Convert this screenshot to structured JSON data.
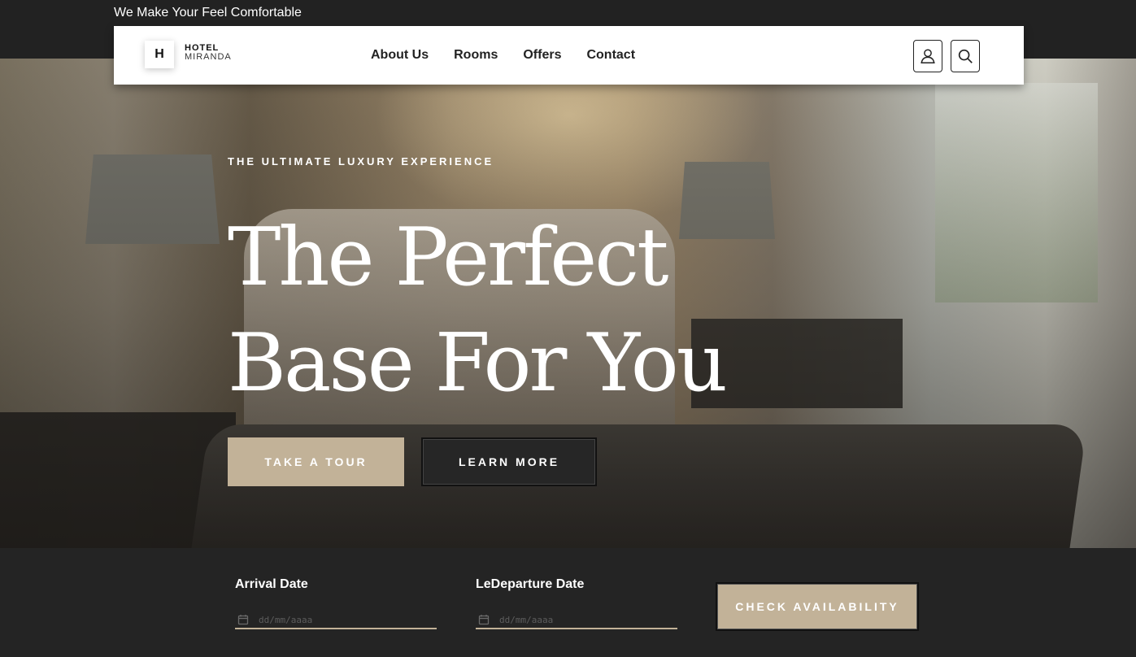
{
  "topbar": {
    "tagline": "We Make Your Feel Comfortable"
  },
  "brand": {
    "mark": "H",
    "line1": "HOTEL",
    "line2": "MIRANDA"
  },
  "nav": {
    "items": [
      {
        "label": "About Us"
      },
      {
        "label": "Rooms"
      },
      {
        "label": "Offers"
      },
      {
        "label": "Contact"
      }
    ],
    "icons": [
      "user-icon",
      "search-icon"
    ]
  },
  "hero": {
    "eyebrow": "THE ULTIMATE LUXURY EXPERIENCE",
    "headline_line1": "The Perfect",
    "headline_line2": "Base For You",
    "primary_button": "TAKE A TOUR",
    "secondary_button": "LEARN MORE"
  },
  "booking": {
    "arrival_label": "Arrival Date",
    "arrival_placeholder": "dd/mm/aaaa",
    "departure_label": "LeDeparture Date",
    "departure_placeholder": "dd/mm/aaaa",
    "submit_label": "CHECK AVAILABILITY"
  },
  "colors": {
    "accent": "#c2b298",
    "dark": "#242424",
    "nav_bg": "#ffffff",
    "text_dark": "#222222"
  }
}
